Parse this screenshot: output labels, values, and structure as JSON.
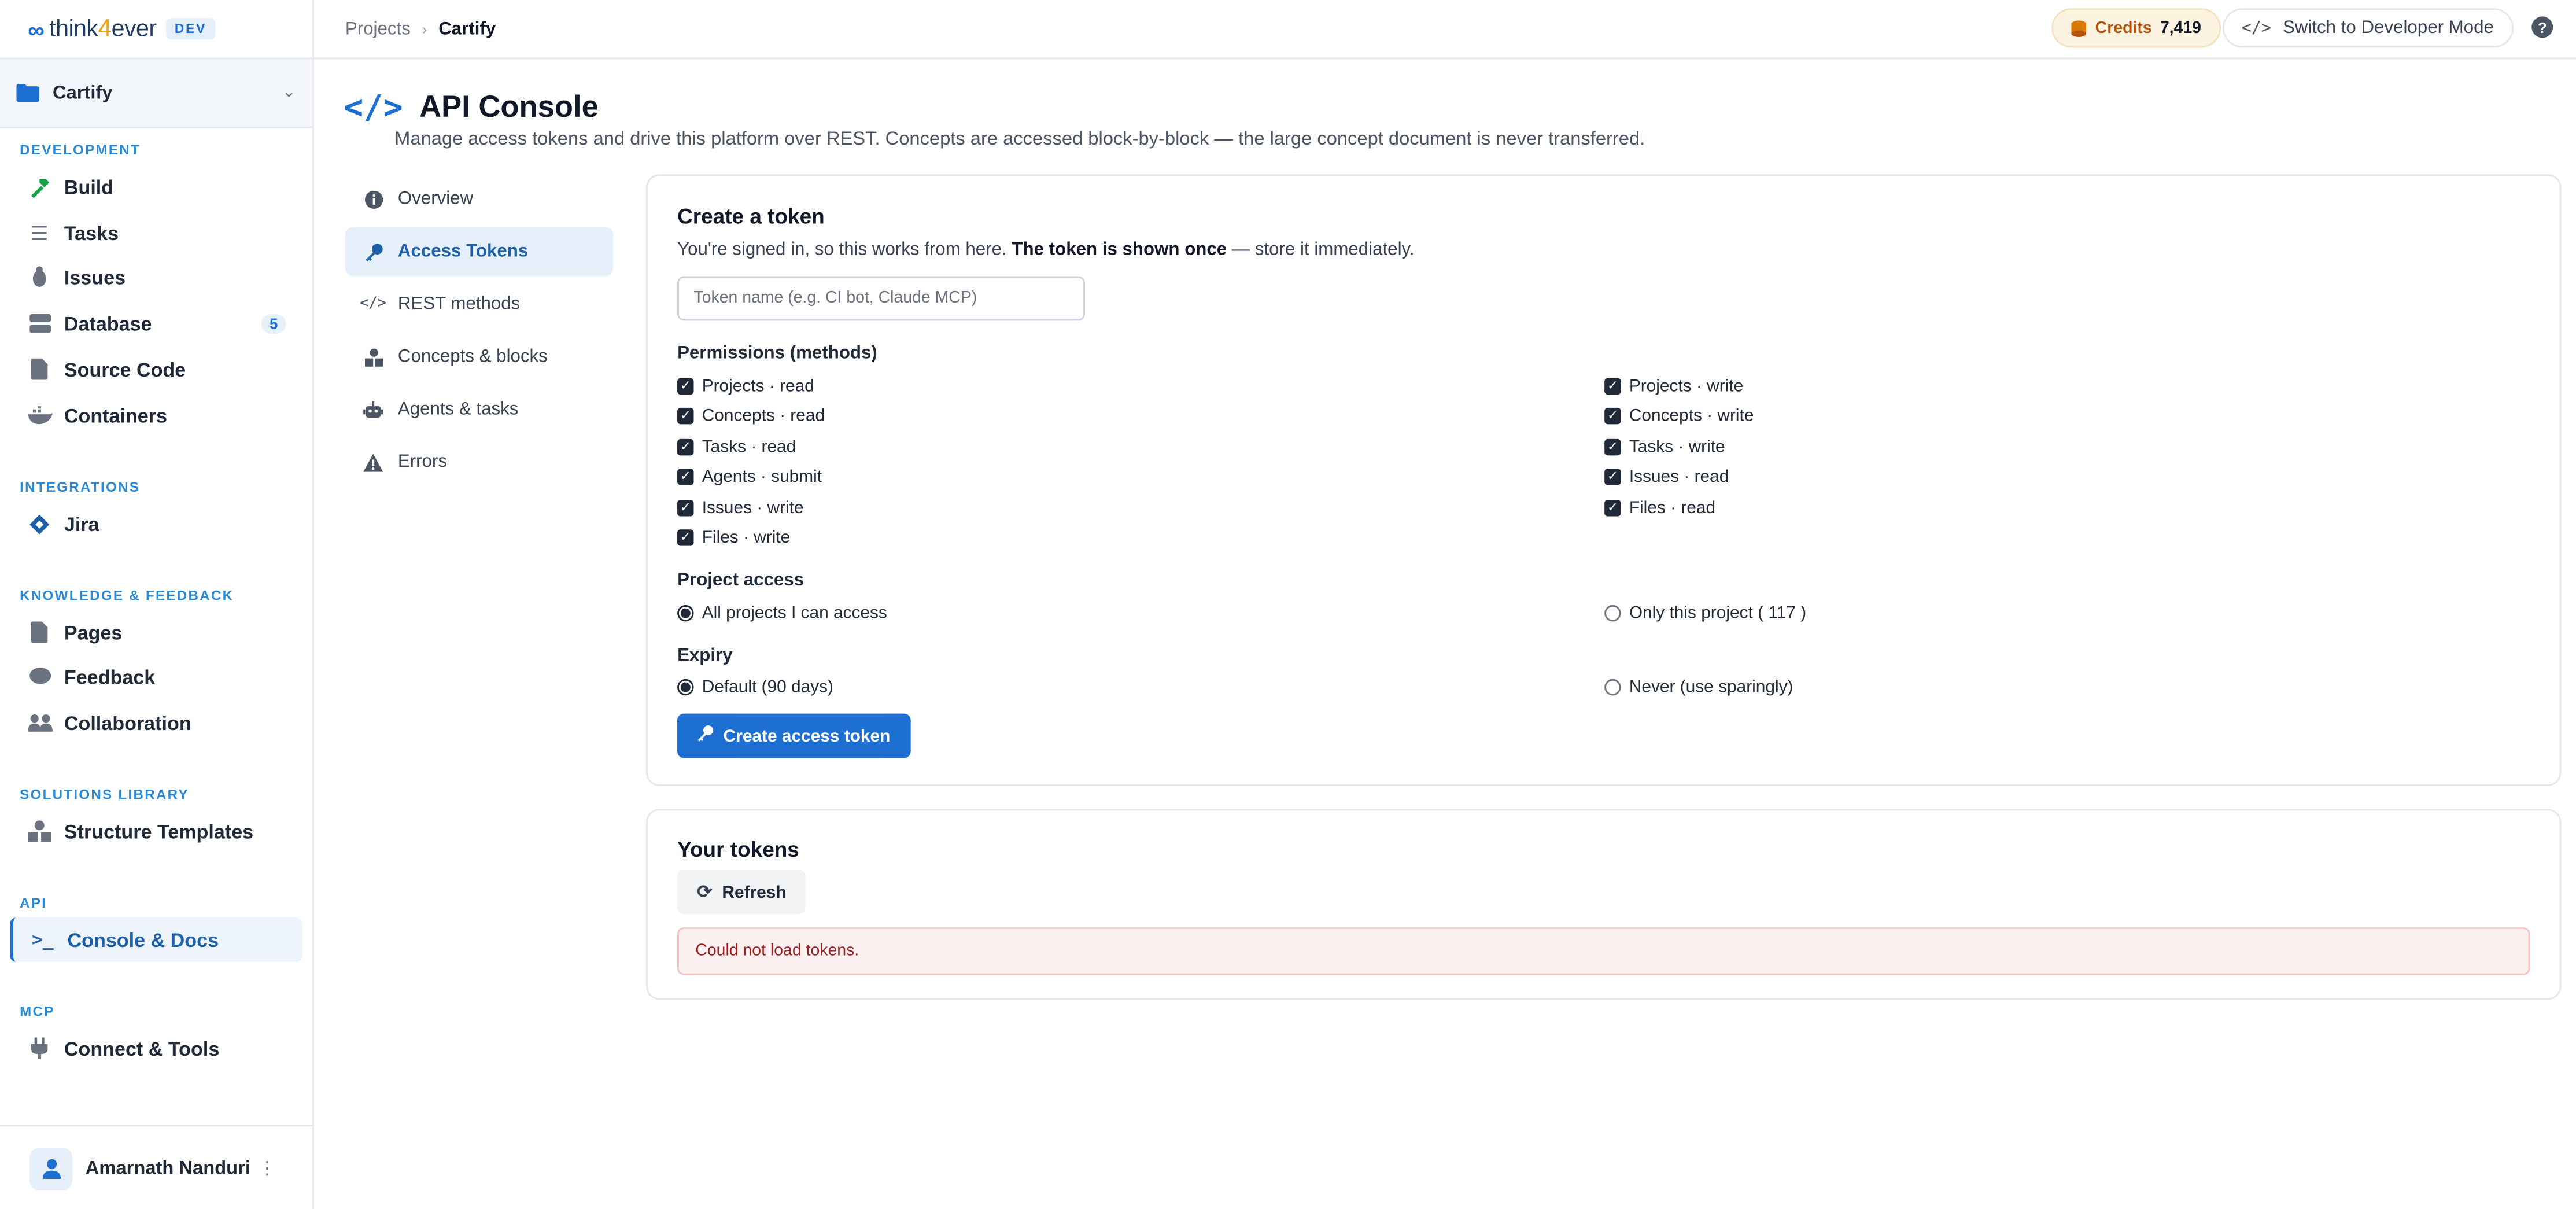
{
  "brand": {
    "logo_prefix": "think",
    "logo_four": "4",
    "logo_suffix": "ever",
    "env_badge": "DEV"
  },
  "project_switcher": {
    "name": "Cartify"
  },
  "sidebar": {
    "sections": [
      {
        "label": "DEVELOPMENT"
      },
      {
        "label": "INTEGRATIONS"
      },
      {
        "label": "KNOWLEDGE & FEEDBACK"
      },
      {
        "label": "SOLUTIONS LIBRARY"
      },
      {
        "label": "API"
      },
      {
        "label": "MCP"
      }
    ],
    "items": [
      {
        "label": "Build",
        "icon": "hammer-icon"
      },
      {
        "label": "Tasks",
        "icon": "list-check-icon"
      },
      {
        "label": "Issues",
        "icon": "bug-icon"
      },
      {
        "label": "Database",
        "icon": "database-icon",
        "count": "5"
      },
      {
        "label": "Source Code",
        "icon": "file-code-icon"
      },
      {
        "label": "Containers",
        "icon": "docker-icon"
      },
      {
        "label": "Jira",
        "icon": "jira-icon"
      },
      {
        "label": "Pages",
        "icon": "page-icon"
      },
      {
        "label": "Feedback",
        "icon": "comment-icon"
      },
      {
        "label": "Collaboration",
        "icon": "users-icon"
      },
      {
        "label": "Structure Templates",
        "icon": "shapes-icon"
      },
      {
        "label": "Console & Docs",
        "icon": "terminal-icon",
        "active": true
      },
      {
        "label": "Connect & Tools",
        "icon": "plug-icon"
      }
    ]
  },
  "user": {
    "name": "Amarnath Nanduri"
  },
  "topbar": {
    "breadcrumb": [
      "Projects",
      "Cartify"
    ],
    "credits_label": "Credits",
    "credits_value": "7,419",
    "dev_mode_label": "Switch to Developer Mode",
    "help_label": "?"
  },
  "page": {
    "title": "API Console",
    "subtitle": "Manage access tokens and drive this platform over REST. Concepts are accessed block-by-block — the large concept document is never transferred."
  },
  "subnav": [
    {
      "label": "Overview",
      "icon": "info-icon"
    },
    {
      "label": "Access Tokens",
      "icon": "key-icon",
      "active": true
    },
    {
      "label": "REST methods",
      "icon": "code-icon"
    },
    {
      "label": "Concepts & blocks",
      "icon": "cubes-icon"
    },
    {
      "label": "Agents & tasks",
      "icon": "robot-icon"
    },
    {
      "label": "Errors",
      "icon": "warning-icon"
    }
  ],
  "create_token": {
    "title": "Create a token",
    "desc_prefix": "You're signed in, so this works from here. ",
    "desc_bold": "The token is shown once",
    "desc_suffix": " — store it immediately.",
    "name_placeholder": "Token name (e.g. CI bot, Claude MCP)",
    "name_value": "",
    "permissions_label": "Permissions (methods)",
    "permissions_left": [
      "Projects · read",
      "Concepts · read",
      "Tasks · read",
      "Agents · submit",
      "Issues · write",
      "Files · write"
    ],
    "permissions_right": [
      "Projects · write",
      "Concepts · write",
      "Tasks · write",
      "Issues · read",
      "Files · read"
    ],
    "project_access_label": "Project access",
    "project_access_all": "All projects I can access",
    "project_access_only_prefix": "Only this project (",
    "project_access_only_id": "117",
    "project_access_only_suffix": ")",
    "project_access_selected": "all",
    "expiry_label": "Expiry",
    "expiry_default": "Default (90 days)",
    "expiry_never": "Never (use sparingly)",
    "expiry_selected": "default",
    "create_button": "Create access token"
  },
  "your_tokens": {
    "title": "Your tokens",
    "refresh_button": "Refresh",
    "error_message": "Could not load tokens."
  },
  "colors": {
    "accent": "#1d6fd1",
    "credits_bg": "#fdf3e1",
    "error_bg": "#fdf0f0"
  }
}
